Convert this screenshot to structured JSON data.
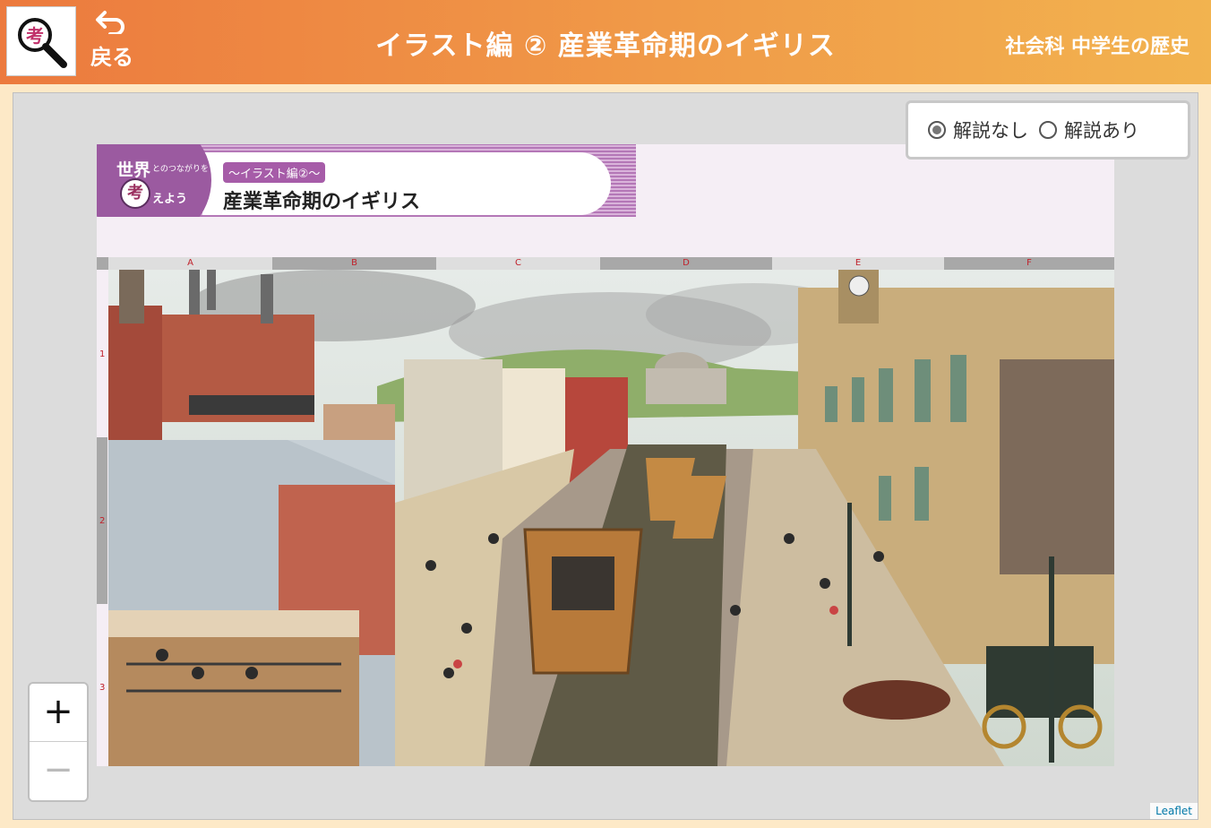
{
  "header": {
    "logo_char": "考",
    "back_label": "戻る",
    "title": "イラスト編 ② 産業革命期のイギリス",
    "subject": "社会科 中学生の歴史"
  },
  "banner": {
    "sekai": "世界",
    "tsunagari": "とのつながりを",
    "kangae": "考",
    "kangae_rest": "えよう",
    "chip": "〜イラスト編②〜",
    "title": "産業革命期のイギリス"
  },
  "grid": {
    "columns": [
      "A",
      "B",
      "C",
      "D",
      "E",
      "F"
    ],
    "rows": [
      "1",
      "2",
      "3"
    ]
  },
  "toggle": {
    "option_off": "解説なし",
    "option_on": "解説あり",
    "selected": "解説なし"
  },
  "zoom": {
    "in_label": "+",
    "out_label": "−"
  },
  "attribution": "Leaflet"
}
